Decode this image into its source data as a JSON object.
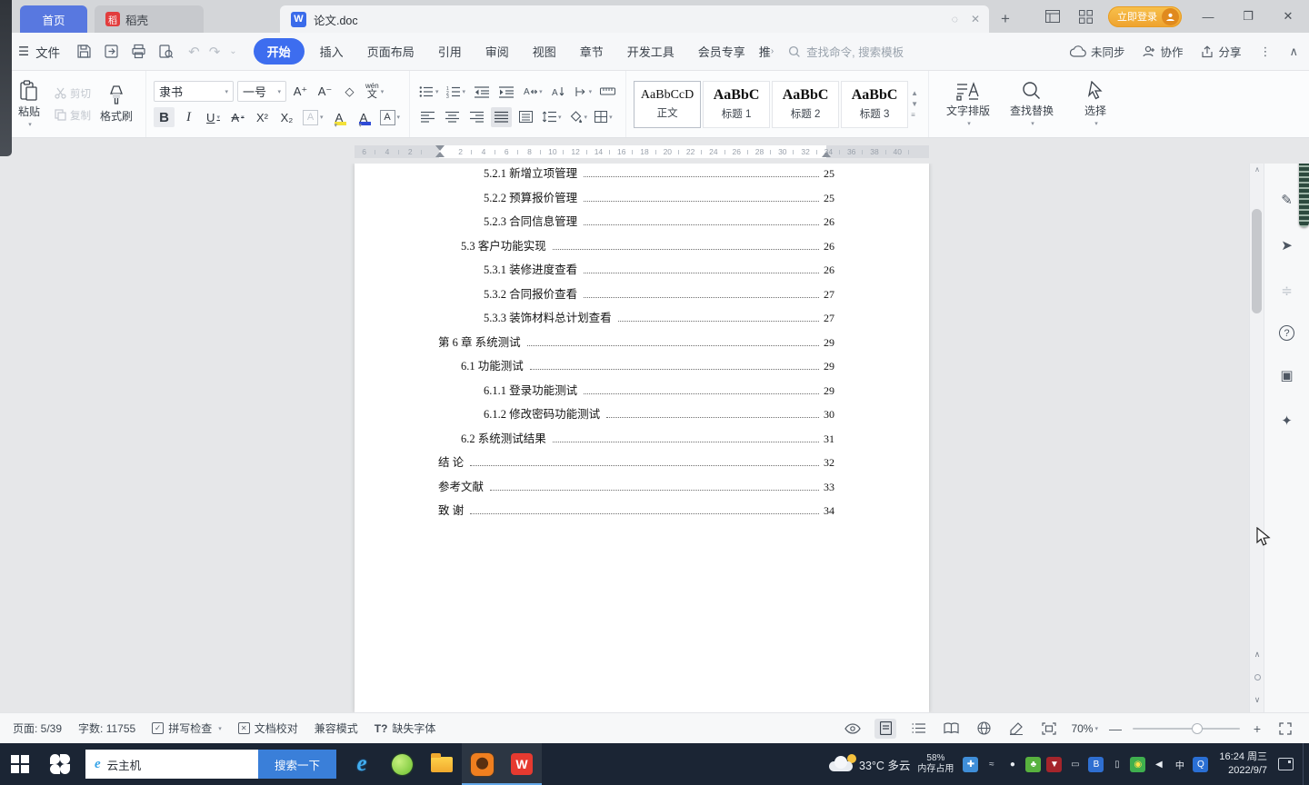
{
  "window": {
    "tab_home": "首页",
    "tab_docer": "稻壳",
    "tab_doc": "论文.doc",
    "login": "立即登录"
  },
  "icons": {
    "hamburger": "☰",
    "undo": "↶",
    "redo": "↷",
    "chevron_down": "⌄",
    "tab_state": "◌",
    "tab_close": "✕",
    "new_tab": "+",
    "win_min": "—",
    "win_max": "❐",
    "win_close": "✕",
    "more_dots": "⋮",
    "collapse": "∧",
    "more_chevron": "›",
    "eraser": "◇",
    "up": "∧",
    "down": "∨"
  },
  "menu": {
    "file": "文件",
    "active": "开始",
    "items": [
      "插入",
      "页面布局",
      "引用",
      "审阅",
      "视图",
      "章节",
      "开发工具",
      "会员专享"
    ],
    "more_tab": "推",
    "search": "查找命令, 搜索模板",
    "sync": "未同步",
    "collab": "协作",
    "share": "分享"
  },
  "fmt": {
    "paste": "粘贴",
    "cut": "剪切",
    "copy": "复制",
    "painter": "格式刷",
    "font_name": "隶书",
    "font_size": "一号",
    "bold": "B",
    "italic": "I",
    "underline": "U",
    "strike": "A",
    "sup": "X²",
    "sub": "X₂",
    "circled": "A",
    "highlight": "A",
    "fontcolor": "A",
    "charbox": "A",
    "wen_top": "wén",
    "wen_bottom": "文",
    "text_layout": "文字排版",
    "find": "查找替换",
    "select": "选择"
  },
  "styles": [
    {
      "sample": "AaBbCcD",
      "label": "正文",
      "cls": "st-body"
    },
    {
      "sample": "AaBbC",
      "label": "标题 1",
      "cls": "st-h1"
    },
    {
      "sample": "AaBbC",
      "label": "标题 2",
      "cls": "st-h2"
    },
    {
      "sample": "AaBbC",
      "label": "标题 3",
      "cls": "st-h3"
    }
  ],
  "ruler": {
    "left": [
      "6",
      "4",
      "2"
    ],
    "right": [
      "2",
      "4",
      "6",
      "8",
      "10",
      "12",
      "14",
      "16",
      "18",
      "20",
      "22",
      "24",
      "26",
      "28",
      "30",
      "32",
      "34",
      "36",
      "38",
      "40"
    ]
  },
  "toc": [
    {
      "cls": "lv3",
      "text": "5.2.1 新增立项管理",
      "page": "25"
    },
    {
      "cls": "lv3",
      "text": "5.2.2 预算报价管理",
      "page": "25"
    },
    {
      "cls": "lv3",
      "text": "5.2.3 合同信息管理",
      "page": "26"
    },
    {
      "cls": "lv2",
      "text": "5.3 客户功能实现",
      "page": "26"
    },
    {
      "cls": "lv3",
      "text": "5.3.1 装修进度查看",
      "page": "26"
    },
    {
      "cls": "lv3",
      "text": "5.3.2 合同报价查看",
      "page": "27"
    },
    {
      "cls": "lv3",
      "text": "5.3.3 装饰材料总计划查看",
      "page": "27"
    },
    {
      "cls": "lv1",
      "text": "第 6 章 系统测试",
      "page": "29"
    },
    {
      "cls": "lv2",
      "text": "6.1 功能测试",
      "page": "29"
    },
    {
      "cls": "lv3",
      "text": "6.1.1 登录功能测试",
      "page": "29"
    },
    {
      "cls": "lv3",
      "text": "6.1.2 修改密码功能测试",
      "page": "30"
    },
    {
      "cls": "lv2",
      "text": "6.2 系统测试结果",
      "page": "31"
    },
    {
      "cls": "lv1",
      "text": "结  论",
      "page": "32"
    },
    {
      "cls": "lv1",
      "text": "参考文献",
      "page": "33"
    },
    {
      "cls": "lv1",
      "text": "致  谢",
      "page": "34"
    }
  ],
  "side_tools": [
    {
      "name": "edit-pen-icon",
      "glyph": "✎",
      "cls": "plain"
    },
    {
      "name": "cursor-select-icon",
      "glyph": "➤",
      "cls": "plain"
    },
    {
      "name": "adjust-sliders-icon",
      "glyph": "≑",
      "cls": "muted"
    },
    {
      "name": "help-icon",
      "glyph": "?",
      "cls": "help"
    },
    {
      "name": "screenshot-ocr-icon",
      "glyph": "▣",
      "cls": "plain"
    },
    {
      "name": "skill-tips-icon",
      "glyph": "✦",
      "cls": "plain"
    }
  ],
  "status": {
    "page": "页面: 5/39",
    "words": "字数: 11755",
    "spell": "拼写检查",
    "proof": "文档校对",
    "compat": "兼容模式",
    "missing_badge": "T?",
    "missing": "缺失字体",
    "zoom": "70%",
    "zoom_minus": "—",
    "zoom_plus": "+"
  },
  "taskbar": {
    "search_value": "云主机",
    "search_btn": "搜索一下",
    "weather_temp": "33°C 多云",
    "mem_pct": "58%",
    "mem_label": "内存占用",
    "wps_w": "W",
    "clock_time": "16:24 周三",
    "clock_date": "2022/9/7",
    "tray": [
      {
        "name": "security-shield-icon",
        "color": "#3f8ed8",
        "fg": "#ffffff",
        "glyph": "✚"
      },
      {
        "name": "wifi-icon",
        "color": "transparent",
        "fg": "#cfd6de",
        "glyph": "≈"
      },
      {
        "name": "bell-icon",
        "color": "transparent",
        "fg": "#e9edf2",
        "glyph": "●"
      },
      {
        "name": "leaf-icon",
        "color": "#58b13e",
        "fg": "#ffffff",
        "glyph": "♣"
      },
      {
        "name": "wine-app-icon",
        "color": "#a5252b",
        "fg": "#ffffff",
        "glyph": "▼"
      },
      {
        "name": "battery-icon",
        "color": "transparent",
        "fg": "#cfd6de",
        "glyph": "▭"
      },
      {
        "name": "bluetooth-icon",
        "color": "#2f6fd1",
        "fg": "#ffffff",
        "glyph": "B"
      },
      {
        "name": "phone-link-icon",
        "color": "transparent",
        "fg": "#cfd6de",
        "glyph": "▯"
      },
      {
        "name": "browser-globe-icon",
        "color": "#3faf4e",
        "fg": "#ffe14a",
        "glyph": "◉"
      },
      {
        "name": "volume-icon",
        "color": "transparent",
        "fg": "#e9edf2",
        "glyph": "◀"
      },
      {
        "name": "ime-indicator",
        "color": "transparent",
        "fg": "#e9edf2",
        "glyph": "中"
      },
      {
        "name": "input-q-icon",
        "color": "#2a6fd4",
        "fg": "#ffffff",
        "glyph": "Q"
      }
    ]
  }
}
